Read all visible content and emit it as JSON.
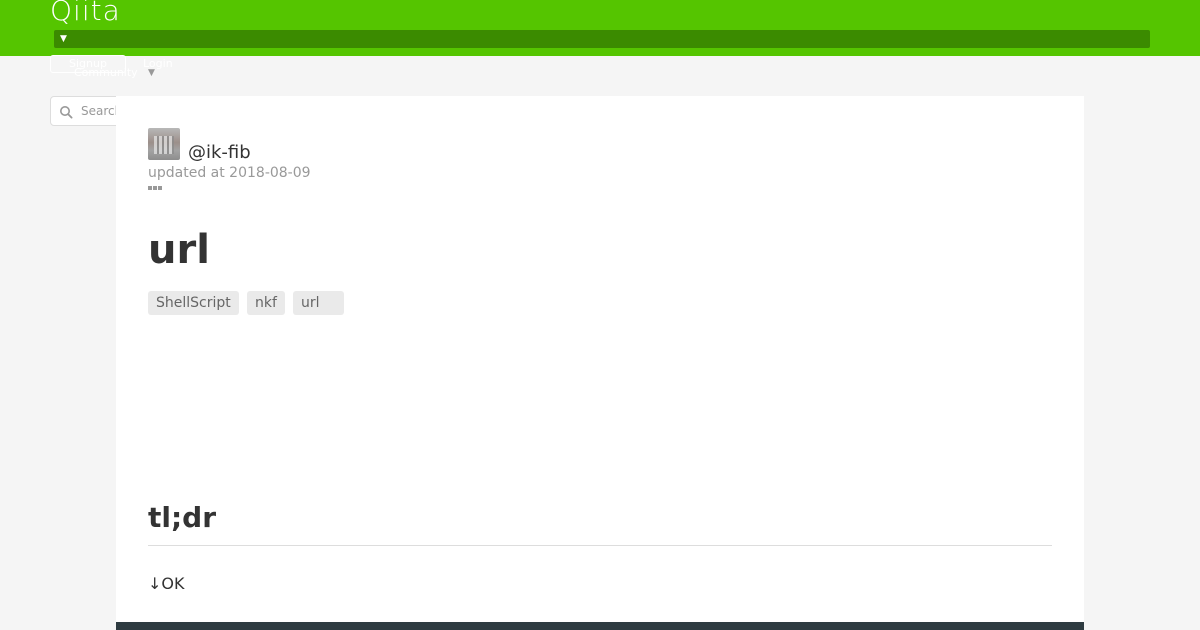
{
  "header": {
    "logo": "Qiita",
    "signup_label": "Signup",
    "login_label": "Login",
    "community_label": "Community",
    "caret_icon": "caret-down-icon"
  },
  "search": {
    "placeholder": "Search",
    "icon": "search-icon"
  },
  "article": {
    "author": "@ik-fib",
    "updated": "updated at 2018-08-09",
    "more_icon": "more-dots-icon",
    "title": "url",
    "tags": [
      "ShellScript",
      "nkf",
      "url"
    ],
    "section_heading": "tl;dr",
    "paragraph": "↓OK"
  },
  "colors": {
    "brand": "#55c500",
    "brand_dark": "#3b8b00",
    "footer": "#2e3b41"
  }
}
